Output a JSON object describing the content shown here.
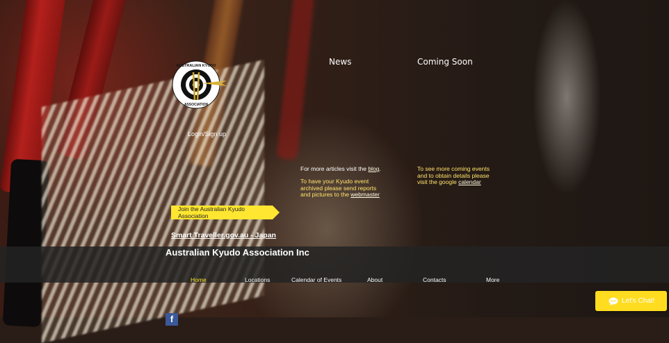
{
  "header": {
    "nav_news": "News",
    "nav_coming_soon": "Coming Soon",
    "login": "Login/Sign up"
  },
  "logo": {
    "text_top": "AUSTRALIAN KYUDO",
    "text_bottom": "ASSOCIATION"
  },
  "news": {
    "line1_prefix": "For more articles visit the ",
    "line1_link": "blog",
    "line1_suffix": ".",
    "line2": "To have your Kyudo event",
    "line3": "archived please send reports",
    "line4_prefix": "and pictures to the ",
    "line4_link": "webmaster"
  },
  "coming_soon": {
    "line1": "To see more coming events",
    "line2": "and to obtain details please",
    "line3_prefix": "visit the google ",
    "line3_link": "calendar"
  },
  "join_button": "Join the Australian Kyudo Association",
  "smart_traveller": "Smart Traveller.gov.au - Japan",
  "site_title": "Australian Kyudo Association Inc",
  "menu": [
    "Home",
    "Locations",
    "Calendar of Events",
    "About",
    "Contacts",
    "More"
  ],
  "social": {
    "facebook": "f"
  },
  "chat_button": "Let's Chat!",
  "colors": {
    "accent": "#ffe630",
    "band": "#232323",
    "text": "#ffffff"
  }
}
